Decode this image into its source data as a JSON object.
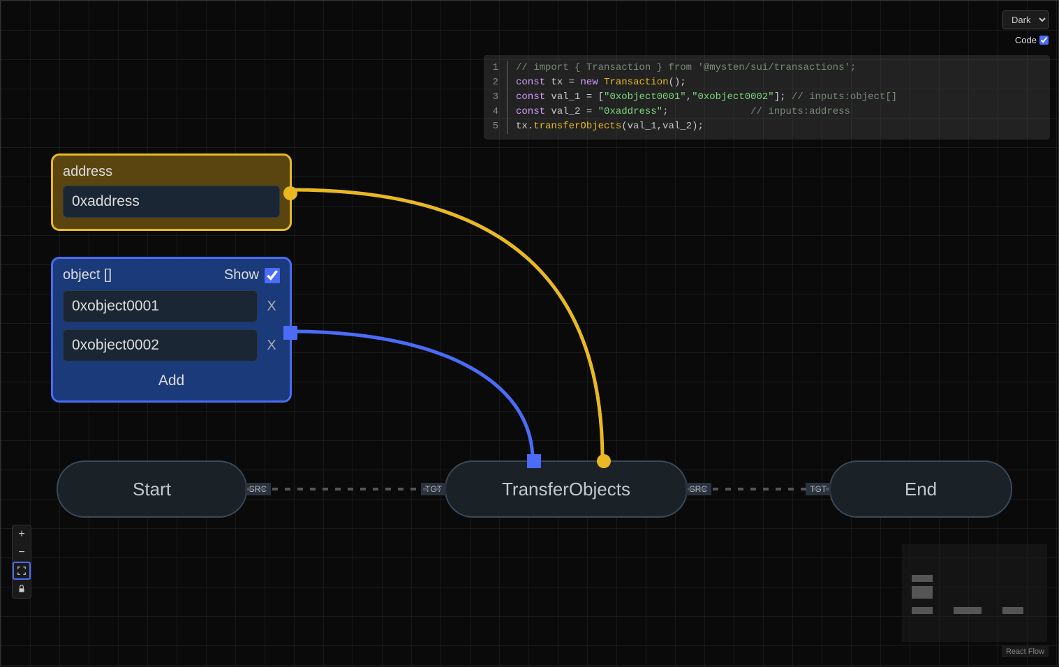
{
  "toolbar": {
    "theme_label": "Dark",
    "code_label": "Code",
    "code_checked": true
  },
  "code": {
    "lines": [
      {
        "n": "1",
        "content": {
          "type": "comment",
          "text": "// import { Transaction } from '@mysten/sui/transactions';"
        }
      },
      {
        "n": "2",
        "content": {
          "type": "line2"
        }
      },
      {
        "n": "3",
        "content": {
          "type": "line3"
        }
      },
      {
        "n": "4",
        "content": {
          "type": "line4"
        }
      },
      {
        "n": "5",
        "content": {
          "type": "line5"
        }
      }
    ],
    "tokens": {
      "const": "const",
      "new": "new",
      "tx": "tx",
      "eq": " = ",
      "Transaction": "Transaction",
      "parens": "();",
      "val1": "val_1",
      "val2": "val_2",
      "arr_open": " = [",
      "obj1": "\"0xobject0001\"",
      "comma": ",",
      "obj2": "\"0xobject0002\"",
      "arr_close": "]; ",
      "comment_obj": "// inputs:object[]",
      "addr_assign": " = ",
      "addr_val": "\"0xaddress\"",
      "semi": ";",
      "pad": "              ",
      "comment_addr": "// inputs:address",
      "dot": ".",
      "transferObjects": "transferObjects",
      "call_args": "(val_1,val_2);"
    }
  },
  "address_node": {
    "label": "address",
    "value": "0xaddress"
  },
  "object_node": {
    "label": "object []",
    "show_label": "Show",
    "show_checked": true,
    "items": [
      "0xobject0001",
      "0xobject0002"
    ],
    "remove_label": "X",
    "add_label": "Add"
  },
  "flow": {
    "start": "Start",
    "transfer": "TransferObjects",
    "end": "End",
    "src": "SRC",
    "tgt": "TGT"
  },
  "attribution": "React Flow",
  "chart_data": {
    "type": "flow-diagram",
    "nodes": [
      {
        "id": "start",
        "label": "Start",
        "kind": "terminal"
      },
      {
        "id": "address",
        "label": "address",
        "kind": "input",
        "value": "0xaddress"
      },
      {
        "id": "object",
        "label": "object []",
        "kind": "input-array",
        "values": [
          "0xobject0001",
          "0xobject0002"
        ]
      },
      {
        "id": "transfer",
        "label": "TransferObjects",
        "kind": "operation"
      },
      {
        "id": "end",
        "label": "End",
        "kind": "terminal"
      }
    ],
    "edges": [
      {
        "from": "start",
        "to": "transfer",
        "kind": "sequence",
        "style": "dashed"
      },
      {
        "from": "transfer",
        "to": "end",
        "kind": "sequence",
        "style": "dashed"
      },
      {
        "from": "address",
        "to": "transfer",
        "kind": "data",
        "port": "address",
        "color": "#e8b923"
      },
      {
        "from": "object",
        "to": "transfer",
        "kind": "data",
        "port": "objects",
        "color": "#4a6cf7"
      }
    ]
  }
}
